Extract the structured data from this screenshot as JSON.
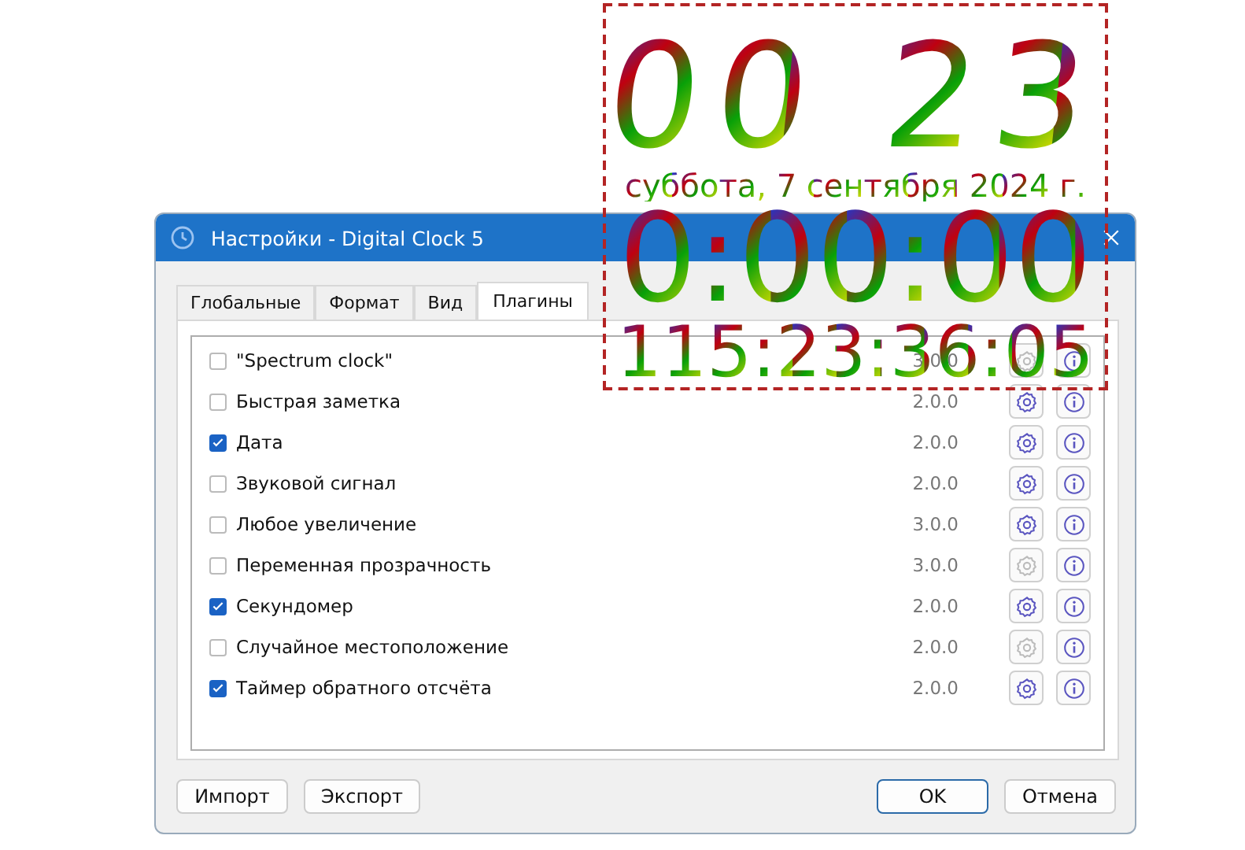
{
  "window": {
    "title": "Настройки - Digital Clock 5"
  },
  "tabs": [
    {
      "label": "Глобальные",
      "selected": false
    },
    {
      "label": "Формат",
      "selected": false
    },
    {
      "label": "Вид",
      "selected": false
    },
    {
      "label": "Плагины",
      "selected": true
    }
  ],
  "plugins": [
    {
      "name": "\"Spectrum clock\"",
      "checked": false,
      "version": "3.0.0",
      "configurable": false
    },
    {
      "name": "Быстрая заметка",
      "checked": false,
      "version": "2.0.0",
      "configurable": true
    },
    {
      "name": "Дата",
      "checked": true,
      "version": "2.0.0",
      "configurable": true
    },
    {
      "name": "Звуковой сигнал",
      "checked": false,
      "version": "2.0.0",
      "configurable": true
    },
    {
      "name": "Любое увеличение",
      "checked": false,
      "version": "3.0.0",
      "configurable": true
    },
    {
      "name": "Переменная прозрачность",
      "checked": false,
      "version": "3.0.0",
      "configurable": false
    },
    {
      "name": "Секундомер",
      "checked": true,
      "version": "2.0.0",
      "configurable": true
    },
    {
      "name": "Случайное местоположение",
      "checked": false,
      "version": "2.0.0",
      "configurable": false
    },
    {
      "name": "Таймер обратного отсчёта",
      "checked": true,
      "version": "2.0.0",
      "configurable": true
    }
  ],
  "left_buttons": [
    {
      "label": "Импорт",
      "focused": false
    },
    {
      "label": "Экспорт",
      "focused": false
    }
  ],
  "right_buttons": [
    {
      "label": "OK",
      "focused": true
    },
    {
      "label": "Отмена",
      "focused": false
    }
  ],
  "clock": {
    "time": "00 23",
    "date": "суббота, 7 сентября 2024 г.",
    "stopwatch": "0:00:00",
    "countdown": "115:23:36:05"
  }
}
